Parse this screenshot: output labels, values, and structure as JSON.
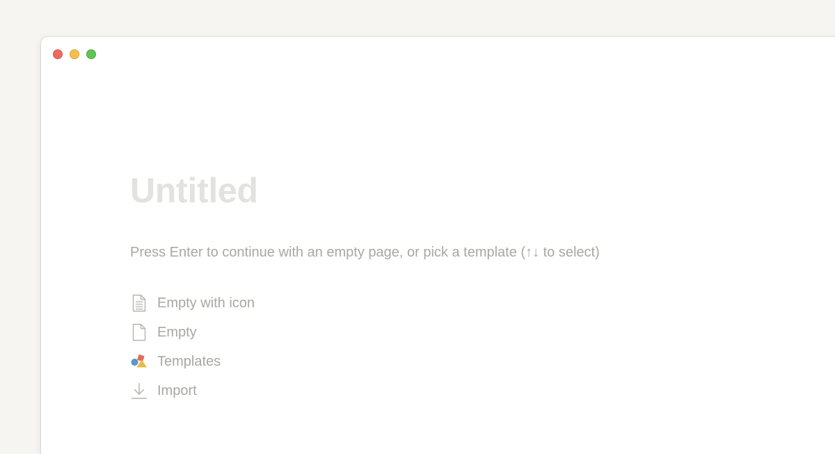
{
  "window": {
    "controls": [
      {
        "name": "close",
        "color": "#ed6a5e"
      },
      {
        "name": "minimize",
        "color": "#f4bf4f"
      },
      {
        "name": "maximize",
        "color": "#61c554"
      }
    ]
  },
  "page": {
    "title_placeholder": "Untitled",
    "hint": "Press Enter to continue with an empty page, or pick a template (↑↓ to select)"
  },
  "options": [
    {
      "label": "Empty with icon",
      "icon": "page-with-lines-icon"
    },
    {
      "label": "Empty",
      "icon": "blank-page-icon"
    },
    {
      "label": "Templates",
      "icon": "templates-shapes-icon"
    },
    {
      "label": "Import",
      "icon": "download-arrow-icon"
    }
  ],
  "colors": {
    "background": "#f6f5f2",
    "window": "#ffffff",
    "placeholder_text": "#e3e2e0",
    "muted_text": "#a8a7a4",
    "templates_red": "#e16b5b",
    "templates_blue": "#5b97c7",
    "templates_yellow": "#e8b94c"
  }
}
